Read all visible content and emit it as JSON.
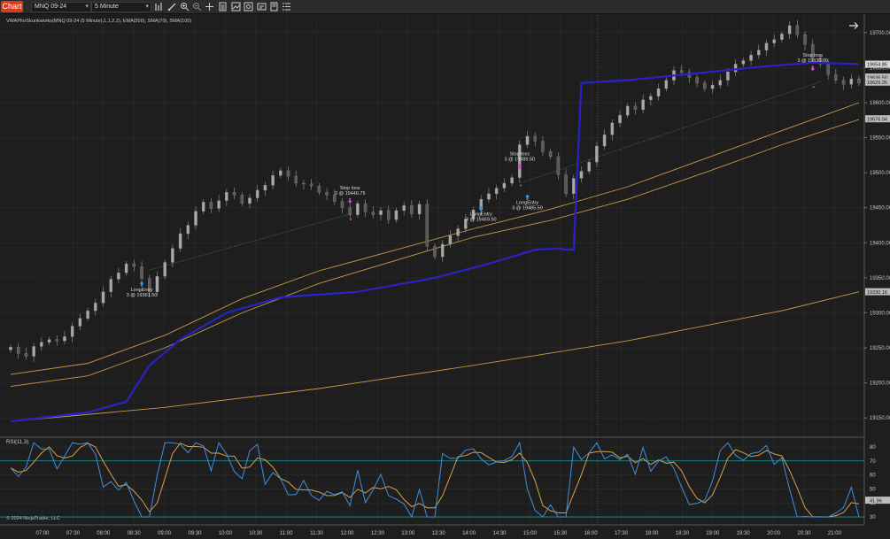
{
  "toolbar": {
    "chart_tab": "Chart",
    "instrument": "MNQ 09-24",
    "interval": "5 Minute"
  },
  "indicator_label": "VWAPforSkunkworks(MNQ 09-24 (5 Minute),1,1,2,2), EMA(500), SMA(70), SMA(100)",
  "rsi_label": "RSI(11,3)",
  "copyright": "© 2024 NinjaTrader, LLC",
  "price_axis": {
    "ticks": [
      19700,
      19650,
      19600,
      19550,
      19500,
      19450,
      19400,
      19350,
      19300,
      19250,
      19200,
      19150
    ],
    "tick_labels": [
      "19700.00",
      "19650.00",
      "19600.00",
      "19550.00",
      "19500.00",
      "19450.00",
      "19400.00",
      "19350.00",
      "19300.00",
      "19250.00",
      "19200.00",
      "19150.00"
    ],
    "badges": [
      {
        "label": "19654.85",
        "value": 19654.85,
        "color": "#2222cc"
      },
      {
        "label": "19636.50",
        "value": 19636.5,
        "color": "#7a7a7a"
      },
      {
        "label": "19629.25",
        "value": 19629.25,
        "color": "#7a7a7a"
      },
      {
        "label": "19576.94",
        "value": 19576.94,
        "color": "#c8a050"
      },
      {
        "label": "19330.16",
        "value": 19330.16,
        "color": "#c8a050"
      }
    ]
  },
  "rsi_axis": {
    "ticks": [
      80,
      70,
      60,
      50,
      40,
      30
    ],
    "tick_labels": [
      "80",
      "70",
      "60",
      "50",
      "40",
      "30"
    ],
    "badge": "41.96",
    "badge_value": 41.96
  },
  "time_axis": {
    "labels": [
      "07:00",
      "07:30",
      "08:00",
      "08:30",
      "09:00",
      "09:30",
      "10:00",
      "10:30",
      "11:00",
      "11:30",
      "12:00",
      "12:30",
      "13:00",
      "13:30",
      "14:00",
      "14:30",
      "15:00",
      "15:30",
      "16:00",
      "17:30",
      "18:00",
      "18:30",
      "19:00",
      "19:30",
      "20:00",
      "20:30",
      "21:00"
    ]
  },
  "trade_markers": [
    {
      "type": "entry",
      "line1": "LongEntry",
      "line2": "3 @ 19361.50",
      "time": "08:50",
      "price": 19361.5
    },
    {
      "type": "exit",
      "line1": "Stop loss",
      "line2": "3 @ 19440.75",
      "time": "11:30",
      "price": 19440.75
    },
    {
      "type": "entry",
      "line1": "LongEntry",
      "line2": "3 @ 19469.50",
      "time": "13:30",
      "price": 19469.5
    },
    {
      "type": "exit",
      "line1": "Stop loss",
      "line2": "3 @ 19489.50",
      "time": "13:55",
      "price": 19489.5
    },
    {
      "type": "entry",
      "line1": "LongEntry",
      "line2": "3 @ 19485.50",
      "time": "14:00",
      "price": 19485.5
    },
    {
      "type": "exit",
      "line1": "Stop loss",
      "line2": "3 @ 19630.00",
      "time": "20:15",
      "price": 19630.0
    }
  ],
  "colors": {
    "background": "#1e1e1e",
    "grid": "#2c2c2c",
    "vwap": "#2a22c8",
    "ma": "#c89a46",
    "entry_arrow": "#2aa0ff",
    "exit_arrow": "#e040e0",
    "rsi_line": "#3f8fe0",
    "rsi_avg": "#d7a04a",
    "rsi_level": "#1a9a9a"
  },
  "chart_data": {
    "type": "line",
    "y_range": [
      19125,
      19725
    ],
    "series": [
      {
        "points": [
          [
            0,
            19251
          ],
          [
            1,
            19242
          ],
          [
            2,
            19238
          ],
          [
            3,
            19252
          ],
          [
            4,
            19258
          ],
          [
            5,
            19262
          ],
          [
            6,
            19260
          ],
          [
            7,
            19266
          ],
          [
            8,
            19281
          ],
          [
            9,
            19292
          ],
          [
            10,
            19303
          ],
          [
            11,
            19314
          ],
          [
            12,
            19330
          ],
          [
            13,
            19348
          ],
          [
            14,
            19357
          ],
          [
            15,
            19370
          ],
          [
            16,
            19366
          ],
          [
            17,
            19349
          ],
          [
            18,
            19330
          ],
          [
            19,
            19352
          ],
          [
            20,
            19372
          ],
          [
            21,
            19392
          ],
          [
            22,
            19413
          ],
          [
            23,
            19425
          ],
          [
            24,
            19445
          ],
          [
            25,
            19458
          ],
          [
            26,
            19449
          ],
          [
            27,
            19460
          ],
          [
            28,
            19472
          ],
          [
            29,
            19468
          ],
          [
            30,
            19456
          ],
          [
            31,
            19464
          ],
          [
            32,
            19475
          ],
          [
            33,
            19482
          ],
          [
            34,
            19496
          ],
          [
            35,
            19503
          ],
          [
            36,
            19495
          ],
          [
            37,
            19485
          ],
          [
            38,
            19484
          ],
          [
            39,
            19481
          ],
          [
            40,
            19472
          ],
          [
            41,
            19468
          ],
          [
            42,
            19459
          ],
          [
            43,
            19450
          ],
          [
            44,
            19440
          ],
          [
            45,
            19456
          ],
          [
            46,
            19444
          ],
          [
            47,
            19440
          ],
          [
            48,
            19446
          ],
          [
            49,
            19433
          ],
          [
            50,
            19446
          ],
          [
            51,
            19453
          ],
          [
            52,
            19441
          ],
          [
            53,
            19455
          ],
          [
            54,
            19395
          ],
          [
            55,
            19380
          ],
          [
            56,
            19398
          ],
          [
            57,
            19410
          ],
          [
            58,
            19420
          ],
          [
            59,
            19434
          ],
          [
            60,
            19447
          ],
          [
            61,
            19462
          ],
          [
            62,
            19470
          ],
          [
            63,
            19478
          ],
          [
            64,
            19485
          ],
          [
            65,
            19493
          ],
          [
            66,
            19540
          ],
          [
            67,
            19552
          ],
          [
            68,
            19545
          ],
          [
            69,
            19530
          ],
          [
            70,
            19523
          ],
          [
            71,
            19497
          ],
          [
            72,
            19470
          ],
          [
            73,
            19492
          ],
          [
            74,
            19502
          ],
          [
            75,
            19515
          ],
          [
            76,
            19538
          ],
          [
            77,
            19554
          ],
          [
            78,
            19571
          ],
          [
            79,
            19582
          ],
          [
            80,
            19595
          ],
          [
            81,
            19590
          ],
          [
            82,
            19604
          ],
          [
            83,
            19609
          ],
          [
            84,
            19620
          ],
          [
            85,
            19632
          ],
          [
            86,
            19646
          ],
          [
            87,
            19643
          ],
          [
            88,
            19636
          ],
          [
            89,
            19628
          ],
          [
            90,
            19620
          ],
          [
            91,
            19625
          ],
          [
            92,
            19632
          ],
          [
            93,
            19644
          ],
          [
            94,
            19655
          ],
          [
            95,
            19660
          ],
          [
            96,
            19668
          ],
          [
            97,
            19675
          ],
          [
            98,
            19685
          ],
          [
            99,
            19690
          ],
          [
            100,
            19698
          ],
          [
            101,
            19710
          ],
          [
            102,
            19697
          ],
          [
            103,
            19683
          ],
          [
            104,
            19664
          ],
          [
            105,
            19655
          ],
          [
            106,
            19640
          ],
          [
            107,
            19632
          ],
          [
            108,
            19626
          ],
          [
            109,
            19634
          ],
          [
            110,
            19628
          ]
        ]
      }
    ]
  }
}
